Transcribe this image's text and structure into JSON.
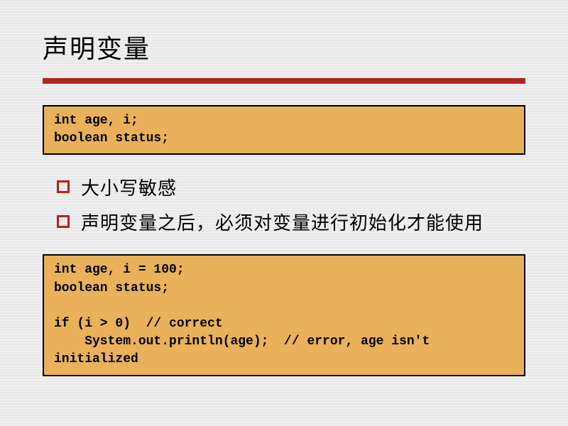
{
  "title": "声明变量",
  "codeBox1": "int age, i;\nboolean status;",
  "bullets": [
    "大小写敏感",
    "声明变量之后，必须对变量进行初始化才能使用"
  ],
  "codeBox2": "int age, i = 100;\nboolean status;\n\nif (i > 0)  // correct\n    System.out.println(age);  // error, age isn't\ninitialized"
}
